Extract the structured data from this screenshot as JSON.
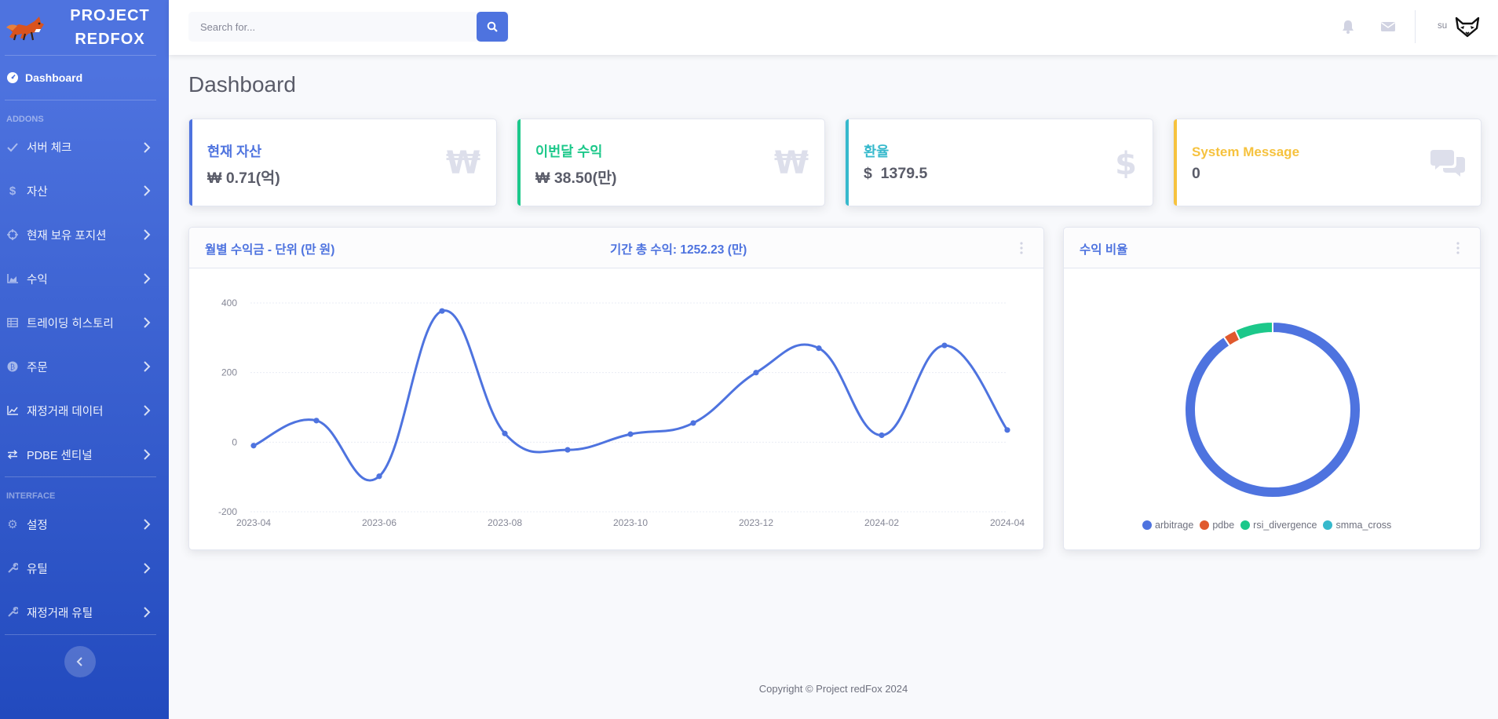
{
  "brand": {
    "line1": "PROJECT",
    "line2": "REDFOX"
  },
  "sidebar": {
    "dashboard_label": "Dashboard",
    "heading_addons": "ADDONS",
    "heading_interface": "INTERFACE",
    "addons": [
      {
        "label": "서버 체크",
        "icon": "check-icon"
      },
      {
        "label": "자산",
        "icon": "dollar-icon"
      },
      {
        "label": "현재 보유 포지션",
        "icon": "crosshairs-icon"
      },
      {
        "label": "수익",
        "icon": "area-chart-icon"
      },
      {
        "label": "트레이딩 히스토리",
        "icon": "table-icon"
      },
      {
        "label": "주문",
        "icon": "coin-icon"
      },
      {
        "label": "재정거래 데이터",
        "icon": "line-chart-icon"
      },
      {
        "label": "PDBE 센티널",
        "icon": "exchange-icon"
      }
    ],
    "interface": [
      {
        "label": "설정",
        "icon": "gear-icon"
      },
      {
        "label": "유틸",
        "icon": "wrench-icon"
      },
      {
        "label": "재정거래 유틸",
        "icon": "wrench-icon"
      }
    ]
  },
  "topbar": {
    "search_placeholder": "Search for...",
    "user_name": "su"
  },
  "page_title": "Dashboard",
  "stats": [
    {
      "label": "현재 자산",
      "value": "₩ 0.71(억)",
      "color": "#4e73df",
      "icon": "won-icon"
    },
    {
      "label": "이번달 수익",
      "value": "₩ 38.50(만)",
      "color": "#1cc88a",
      "icon": "won-icon"
    },
    {
      "label": "환율",
      "value": "$  1379.5",
      "color": "#36b9cc",
      "icon": "dollar-icon"
    },
    {
      "label": "System Message",
      "value": "0",
      "color": "#f6c23e",
      "icon": "comments-icon"
    }
  ],
  "monthly_card": {
    "title": "월별 수익금 - 단위 (만 원)",
    "total": "기간 총 수익: 1252.23 (만)"
  },
  "ratio_card": {
    "title": "수익 비율"
  },
  "chart_data": [
    {
      "type": "line",
      "x": [
        "2023-04",
        "2023-05",
        "2023-06",
        "2023-07",
        "2023-08",
        "2023-09",
        "2023-10",
        "2023-11",
        "2023-12",
        "2024-01",
        "2024-02",
        "2024-03",
        "2024-04"
      ],
      "x_tick_labels": [
        "2023-04",
        "2023-06",
        "2023-08",
        "2023-10",
        "2023-12",
        "2024-02",
        "2024-04"
      ],
      "series": [
        {
          "values": [
            -10,
            62,
            -98,
            377,
            25,
            -22,
            23,
            55,
            200,
            270,
            20,
            278,
            35
          ]
        }
      ],
      "y_ticks": [
        400,
        200,
        0,
        -200
      ],
      "ylim": [
        -200,
        400
      ],
      "color": "#4e73df",
      "grid": true
    },
    {
      "type": "pie",
      "donut": true,
      "labels": [
        "arbitrage",
        "pdbe",
        "rsi_divergence",
        "smma_cross"
      ],
      "values": [
        90.6,
        2.4,
        7.0,
        0.0
      ],
      "colors": [
        "#4e73df",
        "#e0592d",
        "#1cc88a",
        "#36b9cc"
      ],
      "legend": "bottom"
    }
  ],
  "footer": "Copyright © Project redFox 2024"
}
